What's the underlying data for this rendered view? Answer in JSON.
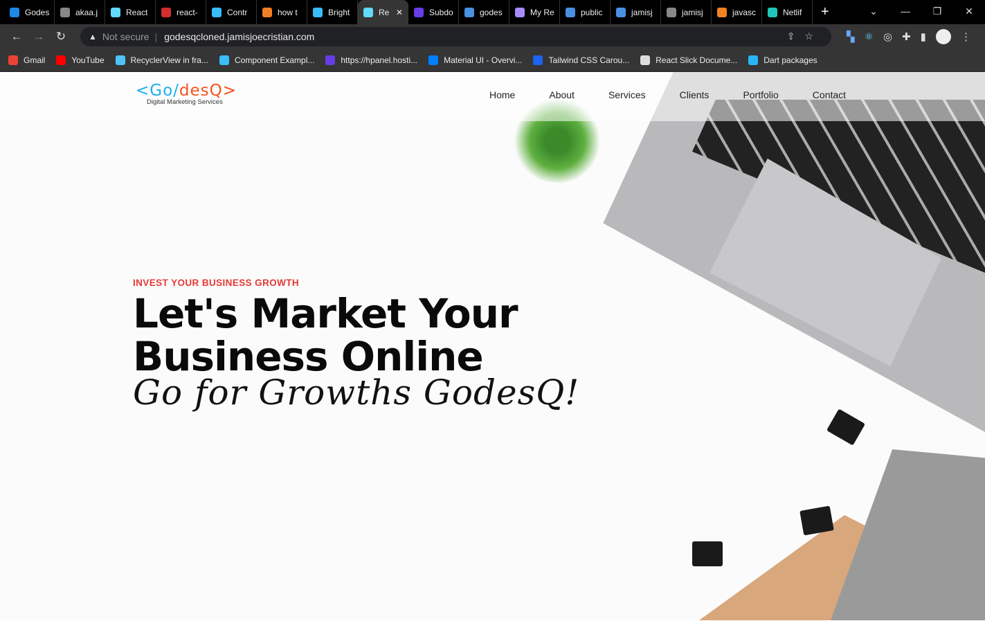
{
  "browser": {
    "tabs": [
      {
        "label": "Godes",
        "color": "#1e88e5"
      },
      {
        "label": "akaa.j",
        "color": "#888"
      },
      {
        "label": "React",
        "color": "#61dafb"
      },
      {
        "label": "react-",
        "color": "#d32f2f"
      },
      {
        "label": "Contr",
        "color": "#38bdf8"
      },
      {
        "label": "how t",
        "color": "#f48024"
      },
      {
        "label": "Bright",
        "color": "#38bdf8"
      },
      {
        "label": "Re",
        "color": "#61dafb",
        "active": true
      },
      {
        "label": "Subdo",
        "color": "#673de6"
      },
      {
        "label": "godes",
        "color": "#4a90e2"
      },
      {
        "label": "My Re",
        "color": "#a78bfa"
      },
      {
        "label": "public",
        "color": "#4a90e2"
      },
      {
        "label": "jamisj",
        "color": "#4a90e2"
      },
      {
        "label": "jamisj",
        "color": "#888"
      },
      {
        "label": "javasc",
        "color": "#f48024"
      },
      {
        "label": "Netlif",
        "color": "#20c6b7"
      }
    ],
    "address": {
      "security": "Not secure",
      "url": "godesqcloned.jamisjoecristian.com"
    },
    "bookmarks": [
      {
        "label": "Gmail",
        "color": "#ea4335"
      },
      {
        "label": "YouTube",
        "color": "#ff0000"
      },
      {
        "label": "RecyclerView in fra...",
        "color": "#4fc3f7"
      },
      {
        "label": "Component Exampl...",
        "color": "#38bdf8"
      },
      {
        "label": "https://hpanel.hosti...",
        "color": "#673de6"
      },
      {
        "label": "Material UI - Overvi...",
        "color": "#007fff"
      },
      {
        "label": "Tailwind CSS Carou...",
        "color": "#1c64f2"
      },
      {
        "label": "React Slick Docume...",
        "color": "#ddd"
      },
      {
        "label": "Dart packages",
        "color": "#29b6f6"
      }
    ]
  },
  "site": {
    "logo": {
      "left": "<Go/",
      "right": "desQ>",
      "tagline": "Digital Marketing Services"
    },
    "nav": [
      "Home",
      "About",
      "Services",
      "Clients",
      "Portfolio",
      "Contact"
    ],
    "hero": {
      "eyebrow": "INVEST YOUR BUSINESS GROWTH",
      "title_line1": "Let's Market Your",
      "title_line2": "Business Online",
      "script": "Go for Growths GodesQ!"
    },
    "colors": {
      "accent": "#e53935",
      "logo_blue": "#1ab0f0",
      "logo_orange": "#f4511e"
    }
  }
}
